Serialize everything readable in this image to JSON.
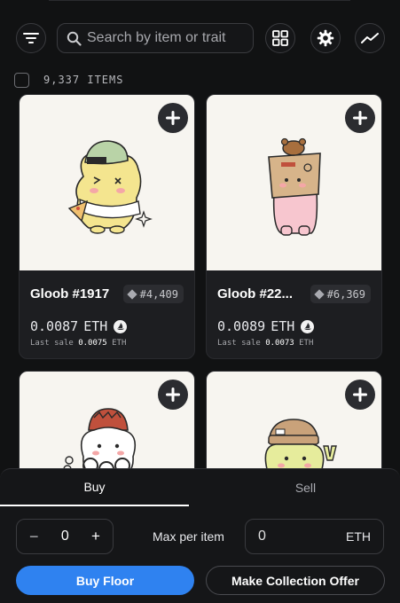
{
  "search": {
    "placeholder": "Search by item or trait"
  },
  "icons": {
    "filter": "filter-icon",
    "search": "search-icon",
    "grid": "grid-view-icon",
    "settings": "gear-icon",
    "activity": "trend-line-icon",
    "add": "plus-icon",
    "rarity": "diamond-icon",
    "marketplace": "opensea-icon"
  },
  "items_count": "9,337 ITEMS",
  "cards": [
    {
      "name": "Gloob #1917",
      "rank": "#4,409",
      "price": "0.0087",
      "currency": "ETH",
      "last_sale_label": "Last sale",
      "last_sale_value": "0.0075",
      "last_sale_currency": "ETH"
    },
    {
      "name": "Gloob #22...",
      "rank": "#6,369",
      "price": "0.0089",
      "currency": "ETH",
      "last_sale_label": "Last sale",
      "last_sale_value": "0.0073",
      "last_sale_currency": "ETH"
    },
    {
      "name": "",
      "rank": "",
      "price": "",
      "currency": ""
    },
    {
      "name": "",
      "rank": "",
      "price": "",
      "currency": ""
    }
  ],
  "panel": {
    "tabs": {
      "buy": "Buy",
      "sell": "Sell"
    },
    "stepper": {
      "minus": "−",
      "value": "0",
      "plus": "+"
    },
    "max_label": "Max per item",
    "price_placeholder": "0",
    "price_unit": "ETH",
    "buy_button": "Buy Floor",
    "offer_button": "Make Collection Offer"
  },
  "colors": {
    "accent": "#2f82f0",
    "background": "#111213",
    "card": "#1d1e21"
  }
}
